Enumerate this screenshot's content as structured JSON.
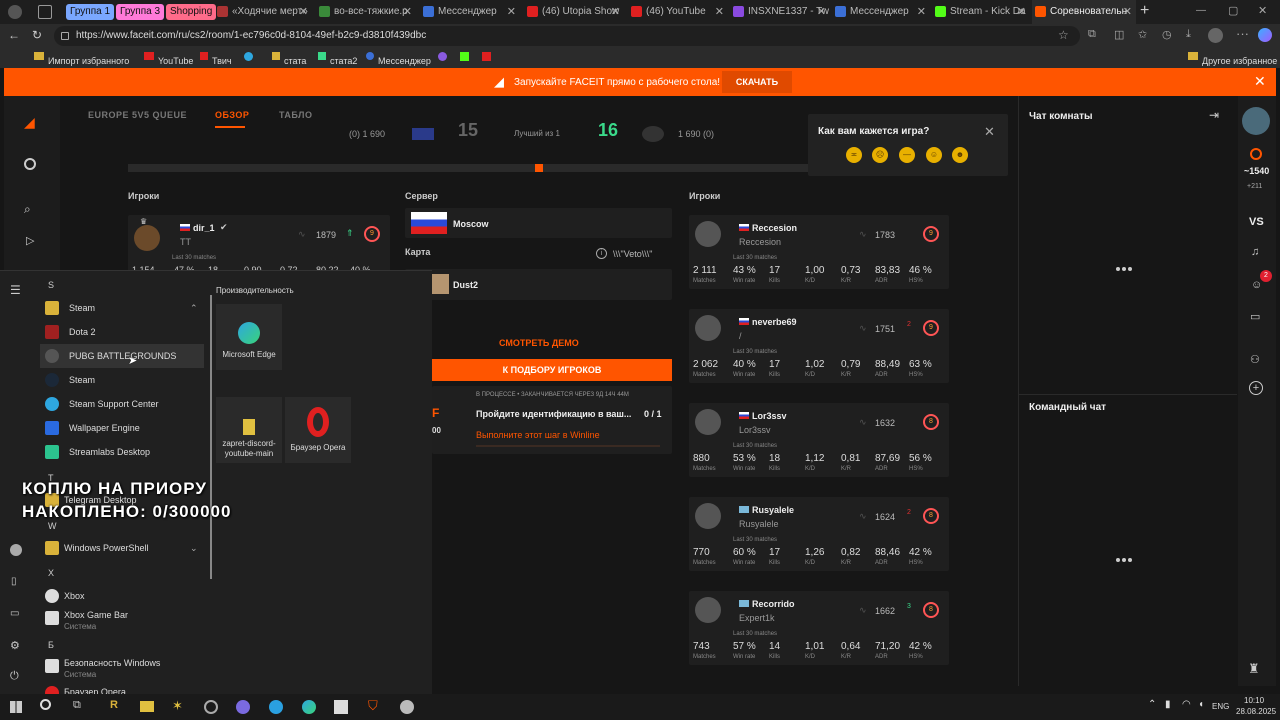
{
  "browser": {
    "groups": [
      "Группа 1",
      "Группа 3",
      "Shopping"
    ],
    "tabs": [
      {
        "title": "«Ходячие мерт»"
      },
      {
        "title": "во-все-тяжкие.р"
      },
      {
        "title": "Мессенджер"
      },
      {
        "title": "(46) Utopia Show"
      },
      {
        "title": "(46) YouTube"
      },
      {
        "title": "INSXNE1337 - Tw"
      },
      {
        "title": "Мессенджер"
      },
      {
        "title": "Stream - Kick Da"
      },
      {
        "title": "Соревновательн"
      }
    ],
    "url": "https://www.faceit.com/ru/cs2/room/1-ec796c0d-8104-49ef-b2c9-d3810f439dbc",
    "bookmarks": [
      "Импорт избранного",
      "YouTube",
      "Твич",
      "стата",
      "стата2",
      "Мессенджер"
    ],
    "other_bookmarks": "Другое избранное"
  },
  "promo": {
    "text": "Запускайте FACEIT прямо с рабочего стола!",
    "button": "СКАЧАТЬ"
  },
  "match_tabs": [
    "EUROPE 5V5 QUEUE",
    "ОБЗОР",
    "ТАБЛО"
  ],
  "score": {
    "left_elo": "(0) 1 690",
    "left_score": "15",
    "mid": "Лучший из 1",
    "right_score": "16",
    "right_elo": "1 690 (0)"
  },
  "left_team": {
    "heading": "Игроки",
    "player": {
      "name": "dir_1",
      "sub": "ТТ",
      "elo": "1879",
      "level": "9",
      "last30": "Last 30 matches",
      "stats": [
        "1 154",
        "47 %",
        "18",
        "0,90",
        "0,72",
        "80,22",
        "40 %"
      ]
    }
  },
  "server": {
    "heading": "Сервер",
    "value": "Moscow"
  },
  "map": {
    "heading": "Карта",
    "veto": "\\\\\\\"Veto\\\\\\\"",
    "value": "Dust2"
  },
  "actions": {
    "demo": "СМОТРЕТЬ ДЕМО",
    "find": "К ПОДБОРУ ИГРОКОВ"
  },
  "quest": {
    "status": "В ПРОЦЕССЕ • ЗАКАНЧИВАЕТСЯ ЧЕРЕЗ 9Д 14Ч 44М",
    "title": "Пройдите идентификацию в ваш...",
    "progress": "0 / 1",
    "link": "Выполните этот шаг в Winline",
    "fragment": "00"
  },
  "right_team": {
    "heading": "Игроки",
    "stat_labels": [
      "Matches",
      "Win rate",
      "Kills",
      "K/D",
      "K/R",
      "ADR",
      "HS%"
    ],
    "last30": "Last 30 matches",
    "players": [
      {
        "name": "Reccesion",
        "sub": "Reccesion",
        "elo": "1783",
        "level": "9",
        "delta": "",
        "stats": [
          "2 111",
          "43 %",
          "17",
          "1,00",
          "0,73",
          "83,83",
          "46 %"
        ]
      },
      {
        "name": "neverbe69",
        "sub": "/",
        "elo": "1751",
        "level": "9",
        "delta": "2",
        "stats": [
          "2 062",
          "40 %",
          "17",
          "1,02",
          "0,79",
          "88,49",
          "63 %"
        ]
      },
      {
        "name": "Lor3ssv",
        "sub": "Lor3ssv",
        "elo": "1632",
        "level": "8",
        "delta": "",
        "stats": [
          "880",
          "53 %",
          "18",
          "1,12",
          "0,81",
          "87,69",
          "56 %"
        ]
      },
      {
        "name": "Rusyalele",
        "sub": "Rusyalele",
        "elo": "1624",
        "level": "8",
        "delta": "2",
        "stats": [
          "770",
          "60 %",
          "17",
          "1,26",
          "0,82",
          "88,46",
          "42 %"
        ]
      },
      {
        "name": "Recorrido",
        "sub": "Expert1k",
        "elo": "1662",
        "level": "8",
        "delta": "3",
        "stats": [
          "743",
          "57 %",
          "14",
          "1,01",
          "0,64",
          "71,20",
          "42 %"
        ]
      }
    ]
  },
  "poll": {
    "question": "Как вам кажется игра?"
  },
  "chat": {
    "room": "Чат комнаты",
    "team": "Командный чат"
  },
  "rightbar": {
    "elo": "~1540",
    "delta": "+211",
    "vs": "VS",
    "badge": "2"
  },
  "start_menu": {
    "letters": [
      "S",
      "T",
      "W",
      "X",
      "Б"
    ],
    "items": [
      "Steam",
      "Dota 2",
      "PUBG BATTLEGROUNDS",
      "Steam",
      "Steam Support Center",
      "Wallpaper Engine",
      "Streamlabs Desktop",
      "Telegram Desktop",
      "Windows PowerShell",
      "Xbox",
      "Xbox Game Bar",
      "Безопасность Windows",
      "Браузер Opera"
    ],
    "item_subs": [
      "Система",
      "Система"
    ],
    "pinned_heading": "Производительность",
    "tiles": [
      "Microsoft Edge",
      "zapret-discord-youtube-main",
      "Браузер Opera"
    ]
  },
  "overlay": {
    "line1": "КОПЛЮ НА ПРИОРУ",
    "line2": "НАКОПЛЕНО: 0/300000"
  },
  "tray": {
    "lang": "ENG",
    "time": "10:10",
    "date": "28.08.2025"
  }
}
